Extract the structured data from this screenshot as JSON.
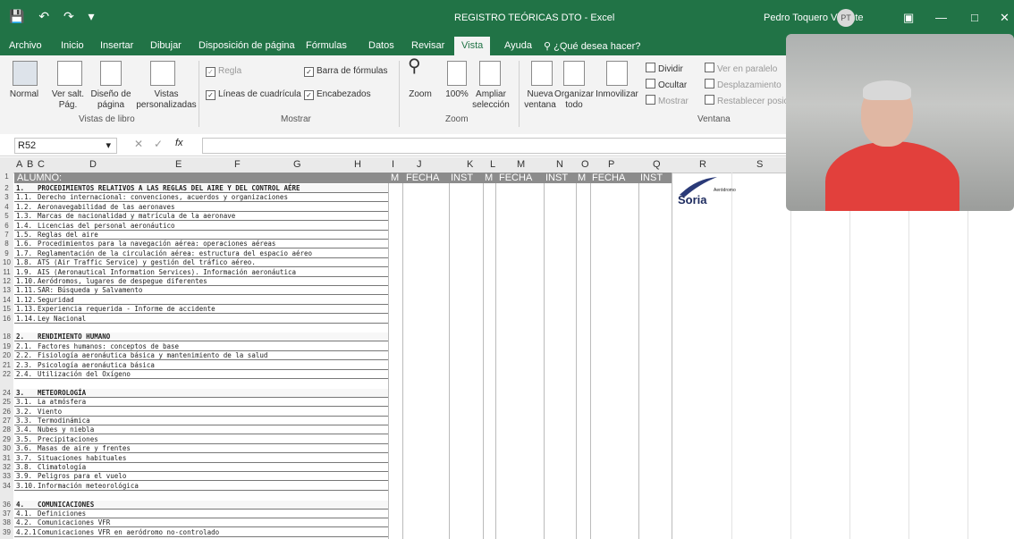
{
  "window": {
    "title": "REGISTRO TEÓRICAS DTO  -  Excel",
    "user": "Pedro Toquero Vicente",
    "avatar_initials": "PT",
    "accent": "#217346"
  },
  "tabs": [
    "Archivo",
    "Inicio",
    "Insertar",
    "Dibujar",
    "Disposición de página",
    "Fórmulas",
    "Datos",
    "Revisar",
    "Vista",
    "Ayuda",
    "¿Qué desea hacer?"
  ],
  "active_tab": "Vista",
  "ribbon": {
    "vistas_libro": {
      "normal": "Normal",
      "saltos": "Ver salt. Pág.",
      "diseno": "Diseño de página",
      "personalizadas": "Vistas personalizadas",
      "group": "Vistas de libro"
    },
    "mostrar": {
      "regla": "Regla",
      "barra_formulas": "Barra de fórmulas",
      "lineas": "Líneas de cuadrícula",
      "encabezados": "Encabezados",
      "group": "Mostrar"
    },
    "zoom": {
      "zoom": "Zoom",
      "cien": "100%",
      "ampliar": "Ampliar selección",
      "group": "Zoom"
    },
    "ventana": {
      "nueva": "Nueva ventana",
      "organizar": "Organizar todo",
      "inmovilizar": "Inmovilizar",
      "dividir": "Dividir",
      "ocultar": "Ocultar",
      "mostrar": "Mostrar",
      "paralelo": "Ver en paralelo",
      "desplazamiento": "Desplazamiento",
      "restablecer": "Restablecer posic",
      "group": "Ventana"
    }
  },
  "formula_bar": {
    "cell": "R52",
    "fx": "fx"
  },
  "columns": [
    "A",
    "B",
    "C",
    "D",
    "E",
    "F",
    "G",
    "H",
    "I",
    "J",
    "K",
    "L",
    "M",
    "N",
    "O",
    "P",
    "Q",
    "R",
    "S"
  ],
  "header_row": {
    "alumno": "ALUMNO:",
    "cells": [
      "M",
      "FECHA",
      "INST",
      "M",
      "FECHA",
      "INST",
      "M",
      "FECHA",
      "INST"
    ]
  },
  "logo": {
    "small": "Aeródromo",
    "big": "Soria"
  },
  "rows": [
    {
      "n": "2",
      "num": "1.",
      "text": "PROCEDIMIENTOS RELATIVOS A LAS REGLAS DEL AIRE Y DEL CONTROL AÉRE",
      "section": true
    },
    {
      "n": "3",
      "num": "1.1.",
      "text": "Derecho internacional: convenciones, acuerdos y organizaciones"
    },
    {
      "n": "4",
      "num": "1.2.",
      "text": "Aeronavegabilidad de las aeronaves"
    },
    {
      "n": "5",
      "num": "1.3.",
      "text": "Marcas de nacionalidad y matrícula de la aeronave"
    },
    {
      "n": "6",
      "num": "1.4.",
      "text": "Licencias del personal aeronáutico"
    },
    {
      "n": "7",
      "num": "1.5.",
      "text": "Reglas del aire"
    },
    {
      "n": "8",
      "num": "1.6.",
      "text": "Procedimientos para la navegación aérea: operaciones aéreas"
    },
    {
      "n": "9",
      "num": "1.7.",
      "text": "Reglamentación de la circulación aérea: estructura del espacio aéreo"
    },
    {
      "n": "10",
      "num": "1.8.",
      "text": "ATS (Air Traffic Service) y gestión del tráfico aéreo."
    },
    {
      "n": "11",
      "num": "1.9.",
      "text": "AIS (Aeronautical Information Services). Información aeronáutica"
    },
    {
      "n": "12",
      "num": "1.10.",
      "text": "Aeródromos, lugares de despegue diferentes"
    },
    {
      "n": "13",
      "num": "1.11.",
      "text": "SAR: Búsqueda y Salvamento"
    },
    {
      "n": "14",
      "num": "1.12.",
      "text": "Seguridad"
    },
    {
      "n": "15",
      "num": "1.13.",
      "text": "Experiencia requerida - Informe de accidente"
    },
    {
      "n": "16",
      "num": "1.14.",
      "text": "Ley Nacional"
    },
    {
      "n": "18",
      "num": "2.",
      "text": "RENDIMIENTO HUMANO",
      "section": true
    },
    {
      "n": "19",
      "num": "2.1.",
      "text": "Factores humanos: conceptos de base"
    },
    {
      "n": "20",
      "num": "2.2.",
      "text": "Fisiología aeronáutica básica y mantenimiento de la salud"
    },
    {
      "n": "21",
      "num": "2.3.",
      "text": "Psicología aeronáutica básica"
    },
    {
      "n": "22",
      "num": "2.4.",
      "text": "Utilización del Oxígeno"
    },
    {
      "n": "24",
      "num": "3.",
      "text": "METEOROLOGÍA",
      "section": true
    },
    {
      "n": "25",
      "num": "3.1.",
      "text": "La atmósfera"
    },
    {
      "n": "26",
      "num": "3.2.",
      "text": "Viento"
    },
    {
      "n": "27",
      "num": "3.3.",
      "text": "Termodinámica"
    },
    {
      "n": "28",
      "num": "3.4.",
      "text": "Nubes y niebla"
    },
    {
      "n": "29",
      "num": "3.5.",
      "text": "Precipitaciones"
    },
    {
      "n": "30",
      "num": "3.6.",
      "text": "Masas de aire y frentes"
    },
    {
      "n": "31",
      "num": "3.7.",
      "text": "Situaciones habituales"
    },
    {
      "n": "32",
      "num": "3.8.",
      "text": "Climatología"
    },
    {
      "n": "33",
      "num": "3.9.",
      "text": "Peligros para el vuelo"
    },
    {
      "n": "34",
      "num": "3.10.",
      "text": "Información meteorológica"
    },
    {
      "n": "36",
      "num": "4.",
      "text": "COMUNICACIONES",
      "section": true
    },
    {
      "n": "37",
      "num": "4.1.",
      "text": "Definiciones"
    },
    {
      "n": "38",
      "num": "4.2.",
      "text": "Comunicaciones VFR"
    },
    {
      "n": "39",
      "num": "4.2.1",
      "text": "Comunicaciones VFR en aeródromo no-controlado"
    }
  ]
}
